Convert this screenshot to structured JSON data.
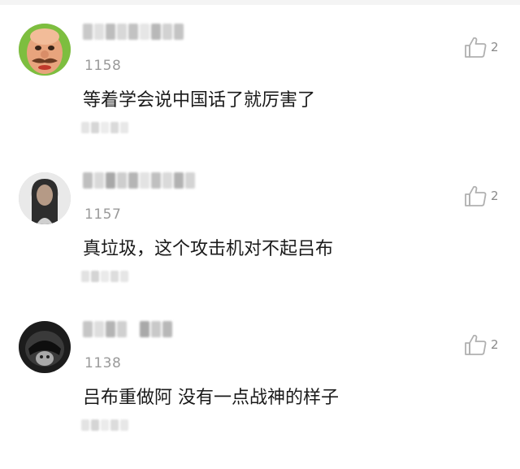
{
  "comments": [
    {
      "number": "1158",
      "text": "等着学会说中国话了就厉害了",
      "likes": "2",
      "avatar_icon": "cartoon-character-avatar"
    },
    {
      "number": "1157",
      "text": "真垃圾，这个攻击机对不起吕布",
      "likes": "2",
      "avatar_icon": "blurred-person-avatar"
    },
    {
      "number": "1138",
      "text": "吕布重做阿 没有一点战神的样子",
      "likes": "2",
      "avatar_icon": "helmet-avatar"
    }
  ],
  "icons": {
    "like": "thumbs-up-icon"
  },
  "colors": {
    "text": "#1a1a1a",
    "meta": "#9a9a9a",
    "background": "#ffffff"
  }
}
